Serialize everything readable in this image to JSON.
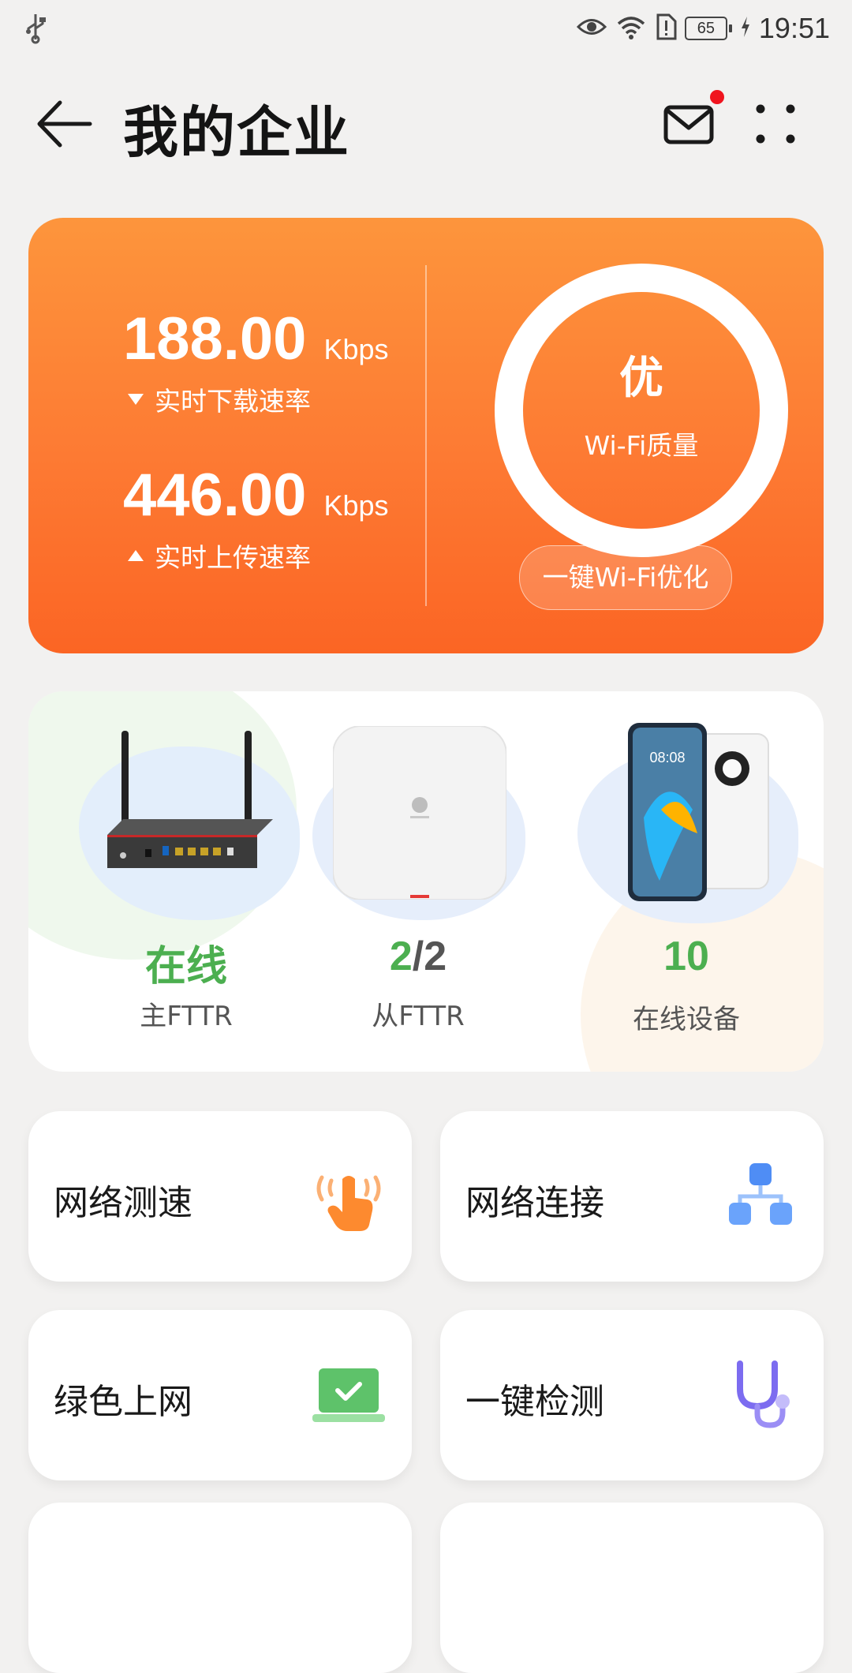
{
  "status_bar": {
    "time": "19:51",
    "battery": "65"
  },
  "header": {
    "title": "我的企业",
    "has_unread_mail": true
  },
  "speed_card": {
    "download": {
      "value": "188.00",
      "unit": "Kbps",
      "label": "实时下载速率"
    },
    "upload": {
      "value": "446.00",
      "unit": "Kbps",
      "label": "实时上传速率"
    },
    "wifi_quality": {
      "grade": "优",
      "label": "Wi-Fi质量"
    },
    "optimize_button": "一键Wi-Fi优化",
    "colors": {
      "gradient_top": "#fd953c",
      "gradient_bottom": "#fb6524"
    }
  },
  "devices": [
    {
      "value": "在线",
      "label": "主FTTR",
      "icon": "router-image"
    },
    {
      "value": "2/2",
      "value_part1": "2",
      "value_part2": "/2",
      "label": "从FTTR",
      "icon": "access-point-image"
    },
    {
      "value": "10",
      "label": "在线设备",
      "icon": "phone-image"
    }
  ],
  "tools": [
    {
      "label": "网络测速",
      "icon": "tap-hand-icon"
    },
    {
      "label": "网络连接",
      "icon": "network-topology-icon"
    },
    {
      "label": "绿色上网",
      "icon": "laptop-check-icon"
    },
    {
      "label": "一键检测",
      "icon": "stethoscope-icon"
    }
  ]
}
